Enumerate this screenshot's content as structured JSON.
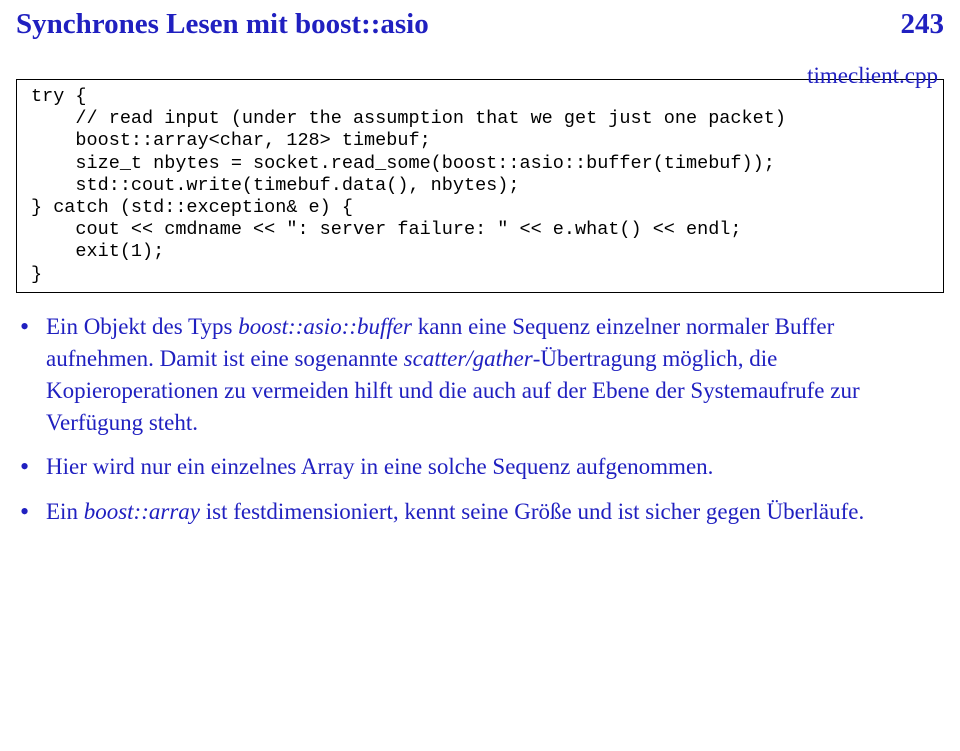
{
  "header": {
    "title": "Synchrones Lesen mit boost::asio",
    "page": "243"
  },
  "filename": "timeclient.cpp",
  "code": "try {\n    // read input (under the assumption that we get just one packet)\n    boost::array<char, 128> timebuf;\n    size_t nbytes = socket.read_some(boost::asio::buffer(timebuf));\n    std::cout.write(timebuf.data(), nbytes);\n} catch (std::exception& e) {\n    cout << cmdname << \": server failure: \" << e.what() << endl;\n    exit(1);\n}",
  "bullets": {
    "b1_a": "Ein Objekt des Typs ",
    "b1_it1": "boost::asio::buffer",
    "b1_b": " kann eine Sequenz einzelner normaler Buffer aufnehmen. Damit ist eine sogenannte ",
    "b1_it2": "scatter/gather",
    "b1_c": "-Übertragung möglich, die Kopieroperationen zu vermeiden hilft und die auch auf der Ebene der Systemaufrufe zur Verfügung steht.",
    "b2": "Hier wird nur ein einzelnes Array in eine solche Sequenz aufgenommen.",
    "b3_a": "Ein ",
    "b3_it1": "boost::array",
    "b3_b": " ist festdimensioniert, kennt seine Größe und ist sicher gegen Überläufe."
  }
}
